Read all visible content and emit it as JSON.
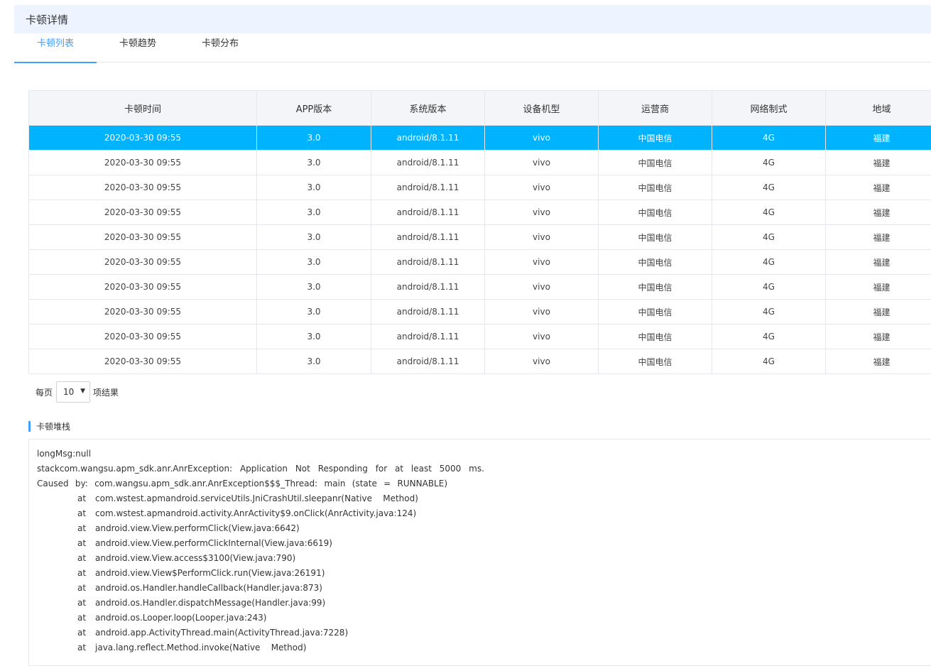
{
  "header": {
    "title": "卡顿详情"
  },
  "tabs": [
    {
      "label": "卡顿列表",
      "active": true
    },
    {
      "label": "卡顿趋势",
      "active": false
    },
    {
      "label": "卡顿分布",
      "active": false
    }
  ],
  "table": {
    "columns": [
      "卡顿时间",
      "APP版本",
      "系统版本",
      "设备机型",
      "运营商",
      "网络制式",
      "地域"
    ],
    "rows": [
      [
        "2020-03-30 09:55",
        "3.0",
        "android/8.1.11",
        "vivo",
        "中国电信",
        "4G",
        "福建"
      ],
      [
        "2020-03-30 09:55",
        "3.0",
        "android/8.1.11",
        "vivo",
        "中国电信",
        "4G",
        "福建"
      ],
      [
        "2020-03-30 09:55",
        "3.0",
        "android/8.1.11",
        "vivo",
        "中国电信",
        "4G",
        "福建"
      ],
      [
        "2020-03-30 09:55",
        "3.0",
        "android/8.1.11",
        "vivo",
        "中国电信",
        "4G",
        "福建"
      ],
      [
        "2020-03-30 09:55",
        "3.0",
        "android/8.1.11",
        "vivo",
        "中国电信",
        "4G",
        "福建"
      ],
      [
        "2020-03-30 09:55",
        "3.0",
        "android/8.1.11",
        "vivo",
        "中国电信",
        "4G",
        "福建"
      ],
      [
        "2020-03-30 09:55",
        "3.0",
        "android/8.1.11",
        "vivo",
        "中国电信",
        "4G",
        "福建"
      ],
      [
        "2020-03-30 09:55",
        "3.0",
        "android/8.1.11",
        "vivo",
        "中国电信",
        "4G",
        "福建"
      ],
      [
        "2020-03-30 09:55",
        "3.0",
        "android/8.1.11",
        "vivo",
        "中国电信",
        "4G",
        "福建"
      ],
      [
        "2020-03-30 09:55",
        "3.0",
        "android/8.1.11",
        "vivo",
        "中国电信",
        "4G",
        "福建"
      ]
    ],
    "selected_index": 0
  },
  "pagination": {
    "prefix": "每页",
    "page_size": "10",
    "suffix": "项结果"
  },
  "stack": {
    "title": "卡顿堆栈",
    "line1": "longMsg:null",
    "line2_words": [
      "stackcom.wangsu.apm_sdk.anr.AnrException:",
      "Application",
      "Not",
      "Responding",
      "for",
      "at",
      "least",
      "5000",
      "ms."
    ],
    "line3_words": [
      "Caused",
      "by:",
      "com.wangsu.apm_sdk.anr.AnrException$$$_Thread:",
      "main",
      "(state",
      "=",
      "RUNNABLE)"
    ],
    "frame_prefix": "at",
    "frames": [
      "com.wstest.apmandroid.serviceUtils.JniCrashUtil.sleepanr(Native    Method)",
      "com.wstest.apmandroid.activity.AnrActivity$9.onClick(AnrActivity.java:124)",
      "android.view.View.performClick(View.java:6642)",
      "android.view.View.performClickInternal(View.java:6619)",
      "android.view.View.access$3100(View.java:790)",
      "android.view.View$PerformClick.run(View.java:26191)",
      "android.os.Handler.handleCallback(Handler.java:873)",
      "android.os.Handler.dispatchMessage(Handler.java:99)",
      "android.os.Looper.loop(Looper.java:243)",
      "android.app.ActivityThread.main(ActivityThread.java:7228)",
      "java.lang.reflect.Method.invoke(Native    Method)"
    ]
  },
  "colors": {
    "accent": "#409eff",
    "selected_row": "#00b3ff",
    "header_bg": "#eef4ff"
  }
}
